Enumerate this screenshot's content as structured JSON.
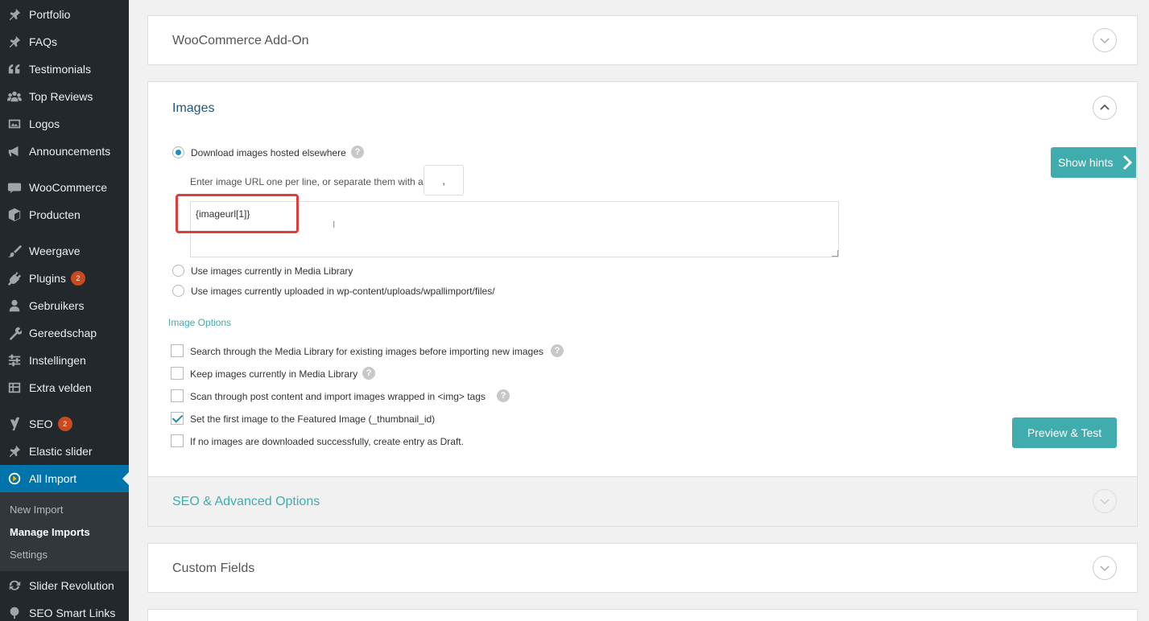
{
  "sidebar": {
    "items": [
      {
        "label": "Portfolio",
        "icon": "pin-icon",
        "name": "portfolio"
      },
      {
        "label": "FAQs",
        "icon": "pin-icon",
        "name": "faqs"
      },
      {
        "label": "Testimonials",
        "icon": "quote-icon",
        "name": "testimonials"
      },
      {
        "label": "Top Reviews",
        "icon": "group-icon",
        "name": "top-reviews"
      },
      {
        "label": "Logos",
        "icon": "image-icon",
        "name": "logos"
      },
      {
        "label": "Announcements",
        "icon": "megaphone-icon",
        "name": "announcements"
      },
      {
        "label": "WooCommerce",
        "icon": "woo-icon",
        "name": "woocommerce"
      },
      {
        "label": "Producten",
        "icon": "box-icon",
        "name": "producten"
      },
      {
        "label": "Weergave",
        "icon": "brush-icon",
        "name": "weergave"
      },
      {
        "label": "Plugins",
        "icon": "plug-icon",
        "name": "plugins",
        "badge": "2"
      },
      {
        "label": "Gebruikers",
        "icon": "user-icon",
        "name": "gebruikers"
      },
      {
        "label": "Gereedschap",
        "icon": "wrench-icon",
        "name": "gereedschap"
      },
      {
        "label": "Instellingen",
        "icon": "sliders-icon",
        "name": "instellingen"
      },
      {
        "label": "Extra velden",
        "icon": "grid-icon",
        "name": "extra-velden"
      },
      {
        "label": "SEO",
        "icon": "yoast-icon",
        "name": "seo",
        "badge": "2"
      },
      {
        "label": "Elastic slider",
        "icon": "pin-icon",
        "name": "elastic-slider"
      },
      {
        "label": "All Import",
        "icon": "import-icon",
        "name": "all-import"
      },
      {
        "label": "Slider Revolution",
        "icon": "refresh-icon",
        "name": "slider-revolution"
      },
      {
        "label": "SEO Smart Links",
        "icon": "globe-icon",
        "name": "seo-smart-links"
      }
    ],
    "submenu": [
      "New Import",
      "Manage Imports",
      "Settings"
    ]
  },
  "panels": {
    "woocommerce": "WooCommerce Add-On",
    "images": "Images",
    "seo": "SEO & Advanced Options",
    "custom_fields": "Custom Fields"
  },
  "images": {
    "download_label": "Download images hosted elsewhere",
    "enter_url_label": "Enter image URL one per line, or separate them with a",
    "separator": ",",
    "url_value": "{imageurl[1]}",
    "media_library_label": "Use images currently in Media Library",
    "uploaded_label": "Use images currently uploaded in wp-content/uploads/wpallimport/files/",
    "options_heading": "Image Options",
    "opt_search": "Search through the Media Library for existing images before importing new images",
    "opt_keep": "Keep images currently in Media Library",
    "opt_scan": "Scan through post content and import images wrapped in <img> tags",
    "opt_featured": "Set the first image to the Featured Image (_thumbnail_id)",
    "opt_draft": "If no images are downloaded successfully, create entry as Draft.",
    "help_glyph": "?"
  },
  "buttons": {
    "show_hints": "Show hints",
    "preview_test": "Preview & Test"
  },
  "colors": {
    "sidebar_bg": "#23282d",
    "active": "#0073aa",
    "teal": "#40acad",
    "badge": "#ca4a1f",
    "highlight": "#e43a3a"
  }
}
